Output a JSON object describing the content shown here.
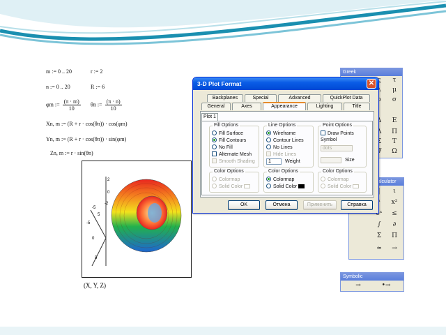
{
  "worksheet": {
    "def_m": "m := 0 .. 20",
    "def_r": "r := 2",
    "def_n": "n := 0 .. 20",
    "def_R": "R := 6",
    "phi_lhs": "φm :=",
    "phi_num": "(π · m)",
    "phi_den": "10",
    "theta_lhs": "θn :=",
    "theta_num": "(π · n)",
    "theta_den": "10",
    "eq_x": "Xn, m := (R + r · cos(θn)) · cos(φm)",
    "eq_y": "Yn, m := (R + r · cos(θn)) · sin(φm)",
    "eq_z": "Zn, m := r · sin(θn)",
    "plot_label": "(X, Y, Z)",
    "axis_ticks": [
      "2",
      "0",
      "-2",
      "-5",
      "5",
      "-5",
      "0",
      "5"
    ]
  },
  "dialog": {
    "title": "3-D Plot Format",
    "close_icon": "close-icon",
    "tabs_back": [
      "Backplanes",
      "Special",
      "Advanced",
      "QuickPlot Data"
    ],
    "tabs_front": [
      "General",
      "Axes",
      "Appearance",
      "Lighting",
      "Title"
    ],
    "active_tab": "Appearance",
    "plot_tab": "Plot 1",
    "fill_options": {
      "title": "Fill Options",
      "fill_surface": "Fill Surface",
      "fill_contours": "Fill Contours",
      "no_fill": "No Fill",
      "alternate_mesh": "Alternate Mesh",
      "smooth_shading": "Smooth Shading"
    },
    "line_options": {
      "title": "Line Options",
      "wireframe": "Wireframe",
      "contour_lines": "Contour Lines",
      "no_lines": "No Lines",
      "hide_lines": "Hide Lines",
      "weight_value": "1",
      "weight_label": "Weight"
    },
    "point_options": {
      "title": "Point Options",
      "draw_points": "Draw Points",
      "symbol_label": "Symbol",
      "symbol_value": "dots",
      "size_label": "Size"
    },
    "color_options": {
      "title": "Color Options",
      "colormap": "Colormap",
      "solid_color": "Solid Color"
    },
    "buttons": {
      "ok": "OK",
      "cancel": "Отмена",
      "apply": "Применить",
      "help": "Справка"
    }
  },
  "greek_palette": {
    "title": "Greek",
    "glyphs": [
      "ς",
      "τ",
      "λ",
      "μ",
      "ρ",
      "σ",
      "Δ",
      "Ε",
      "Λ",
      "Π",
      "Σ",
      "Τ",
      "Ψ",
      "Ω"
    ]
  },
  "calculator_palette": {
    "title": "Calculator",
    "glyphs": [
      "|",
      "ι",
      "ⁿ",
      "x²",
      "eˣ",
      "≤",
      "∫",
      "∂",
      "Σ",
      "Π",
      "≈",
      "→"
    ]
  },
  "symbolic_palette": {
    "title": "Symbolic",
    "glyphs": [
      "→",
      "•→"
    ]
  },
  "colors": {
    "dialog_title_blue": "#0a5de6",
    "torus_red": "#e8261f",
    "torus_green": "#22b14c",
    "torus_blue": "#1e66d0",
    "slide_teal": "#1a8fb0"
  }
}
